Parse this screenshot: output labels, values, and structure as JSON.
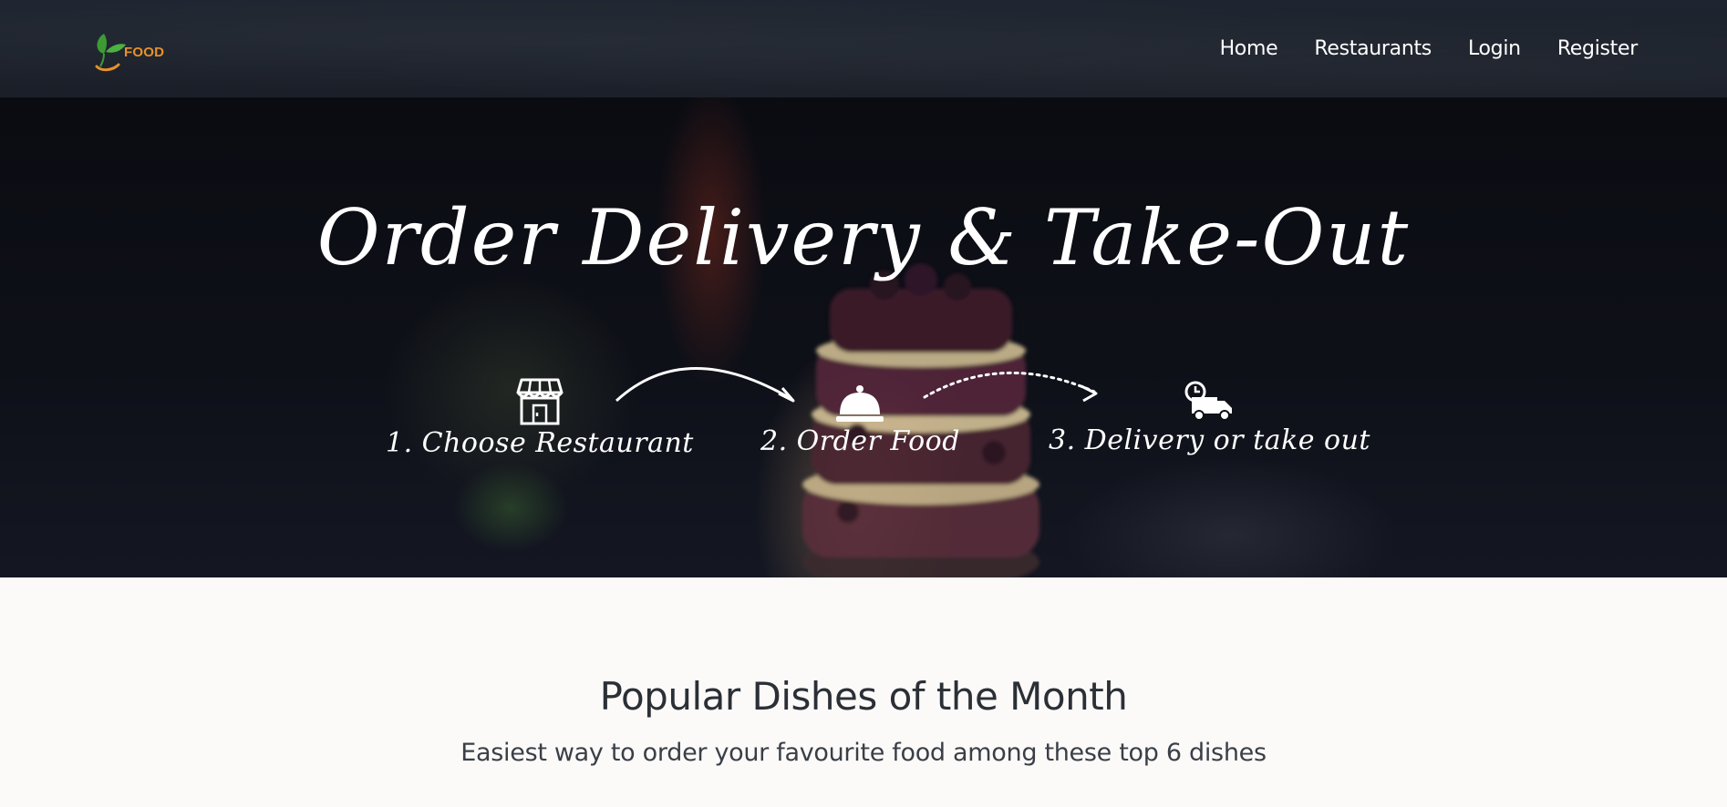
{
  "navbar": {
    "logo_text": "FOOD",
    "links": [
      "Home",
      "Restaurants",
      "Login",
      "Register"
    ]
  },
  "hero": {
    "title": "Order Delivery & Take-Out",
    "steps": [
      {
        "label": "1. Choose Restaurant",
        "icon": "storefront-icon"
      },
      {
        "label": "2. Order Food",
        "icon": "cloche-icon"
      },
      {
        "label": "3. Delivery or take out",
        "icon": "delivery-truck-icon"
      }
    ]
  },
  "popular": {
    "title": "Popular Dishes of the Month",
    "subtitle": "Easiest way to order your favourite food among these top 6 dishes"
  },
  "colors": {
    "navbar_bg": "#1c212b",
    "logo_orange": "#e8912a",
    "logo_green": "#3d9b35",
    "page_bg": "#fbfaf8",
    "text_dark": "#2b2f36"
  }
}
